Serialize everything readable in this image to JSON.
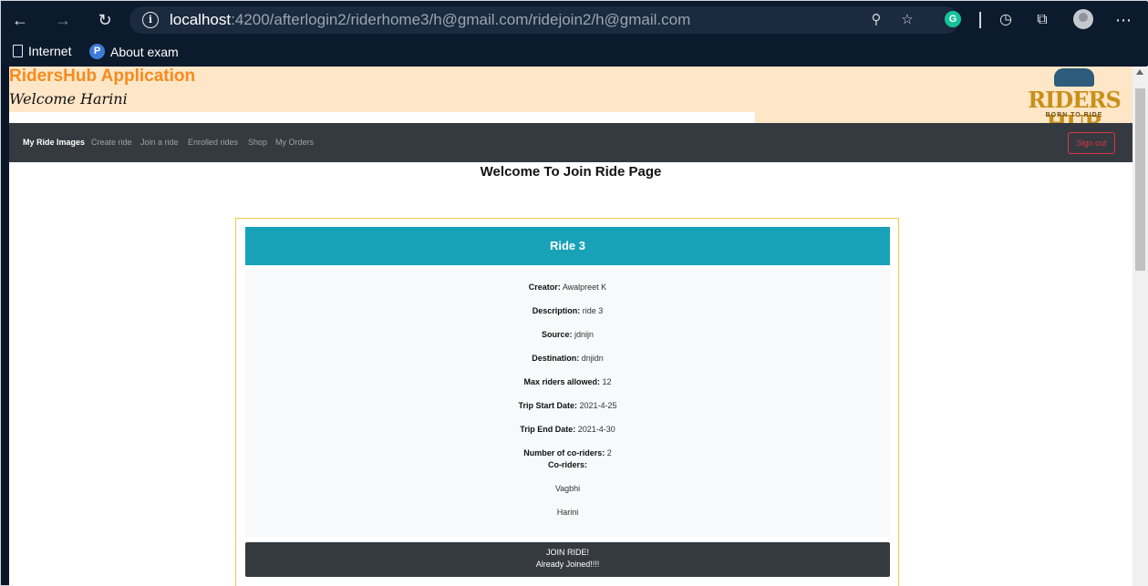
{
  "browser": {
    "url_host": "localhost",
    "url_rest": ":4200/afterlogin2/riderhome3/h@gmail.com/ridejoin2/h@gmail.com",
    "favorites": [
      {
        "label": "Internet"
      },
      {
        "label": "About exam"
      }
    ]
  },
  "header": {
    "app_title": "RidersHub Application",
    "welcome": "Welcome Harini",
    "logo_text": "RIDERS HUB",
    "logo_sub": "BORN TO RIDE"
  },
  "nav": {
    "items": [
      {
        "label": "My Ride Images"
      },
      {
        "label": "Create ride"
      },
      {
        "label": "Join a ride"
      },
      {
        "label": "Enrolled rides"
      },
      {
        "label": "Shop"
      },
      {
        "label": "My Orders"
      }
    ],
    "signout_label": "Sign out"
  },
  "page": {
    "title": "Welcome To Join Ride Page"
  },
  "ride": {
    "name": "Ride 3",
    "fields": [
      {
        "label": "Creator:",
        "value": "Awalpreet K"
      },
      {
        "label": "Description:",
        "value": "ride 3"
      },
      {
        "label": "Source:",
        "value": "jdnijn"
      },
      {
        "label": "Destination:",
        "value": "dnjidn"
      },
      {
        "label": "Max riders allowed:",
        "value": "12"
      },
      {
        "label": "Trip Start Date:",
        "value": "2021-4-25"
      },
      {
        "label": "Trip End Date:",
        "value": "2021-4-30"
      },
      {
        "label": "Number of co-riders:",
        "value": "2"
      }
    ],
    "coriders_label": "Co-riders:",
    "coriders": [
      "Vagbhi",
      "Harini"
    ],
    "join_label": "JOIN RIDE!",
    "joined_status": "Already Joined!!!!"
  }
}
